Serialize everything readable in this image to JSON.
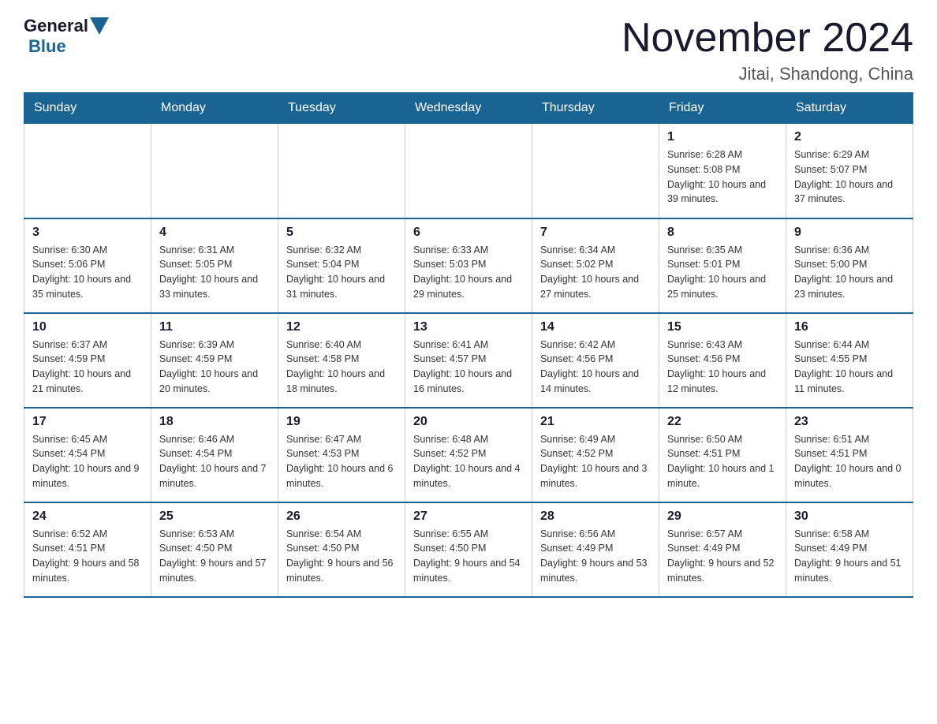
{
  "header": {
    "logo_general": "General",
    "logo_blue": "Blue",
    "month_title": "November 2024",
    "location": "Jitai, Shandong, China"
  },
  "weekdays": [
    "Sunday",
    "Monday",
    "Tuesday",
    "Wednesday",
    "Thursday",
    "Friday",
    "Saturday"
  ],
  "weeks": [
    [
      {
        "day": "",
        "info": ""
      },
      {
        "day": "",
        "info": ""
      },
      {
        "day": "",
        "info": ""
      },
      {
        "day": "",
        "info": ""
      },
      {
        "day": "",
        "info": ""
      },
      {
        "day": "1",
        "info": "Sunrise: 6:28 AM\nSunset: 5:08 PM\nDaylight: 10 hours and 39 minutes."
      },
      {
        "day": "2",
        "info": "Sunrise: 6:29 AM\nSunset: 5:07 PM\nDaylight: 10 hours and 37 minutes."
      }
    ],
    [
      {
        "day": "3",
        "info": "Sunrise: 6:30 AM\nSunset: 5:06 PM\nDaylight: 10 hours and 35 minutes."
      },
      {
        "day": "4",
        "info": "Sunrise: 6:31 AM\nSunset: 5:05 PM\nDaylight: 10 hours and 33 minutes."
      },
      {
        "day": "5",
        "info": "Sunrise: 6:32 AM\nSunset: 5:04 PM\nDaylight: 10 hours and 31 minutes."
      },
      {
        "day": "6",
        "info": "Sunrise: 6:33 AM\nSunset: 5:03 PM\nDaylight: 10 hours and 29 minutes."
      },
      {
        "day": "7",
        "info": "Sunrise: 6:34 AM\nSunset: 5:02 PM\nDaylight: 10 hours and 27 minutes."
      },
      {
        "day": "8",
        "info": "Sunrise: 6:35 AM\nSunset: 5:01 PM\nDaylight: 10 hours and 25 minutes."
      },
      {
        "day": "9",
        "info": "Sunrise: 6:36 AM\nSunset: 5:00 PM\nDaylight: 10 hours and 23 minutes."
      }
    ],
    [
      {
        "day": "10",
        "info": "Sunrise: 6:37 AM\nSunset: 4:59 PM\nDaylight: 10 hours and 21 minutes."
      },
      {
        "day": "11",
        "info": "Sunrise: 6:39 AM\nSunset: 4:59 PM\nDaylight: 10 hours and 20 minutes."
      },
      {
        "day": "12",
        "info": "Sunrise: 6:40 AM\nSunset: 4:58 PM\nDaylight: 10 hours and 18 minutes."
      },
      {
        "day": "13",
        "info": "Sunrise: 6:41 AM\nSunset: 4:57 PM\nDaylight: 10 hours and 16 minutes."
      },
      {
        "day": "14",
        "info": "Sunrise: 6:42 AM\nSunset: 4:56 PM\nDaylight: 10 hours and 14 minutes."
      },
      {
        "day": "15",
        "info": "Sunrise: 6:43 AM\nSunset: 4:56 PM\nDaylight: 10 hours and 12 minutes."
      },
      {
        "day": "16",
        "info": "Sunrise: 6:44 AM\nSunset: 4:55 PM\nDaylight: 10 hours and 11 minutes."
      }
    ],
    [
      {
        "day": "17",
        "info": "Sunrise: 6:45 AM\nSunset: 4:54 PM\nDaylight: 10 hours and 9 minutes."
      },
      {
        "day": "18",
        "info": "Sunrise: 6:46 AM\nSunset: 4:54 PM\nDaylight: 10 hours and 7 minutes."
      },
      {
        "day": "19",
        "info": "Sunrise: 6:47 AM\nSunset: 4:53 PM\nDaylight: 10 hours and 6 minutes."
      },
      {
        "day": "20",
        "info": "Sunrise: 6:48 AM\nSunset: 4:52 PM\nDaylight: 10 hours and 4 minutes."
      },
      {
        "day": "21",
        "info": "Sunrise: 6:49 AM\nSunset: 4:52 PM\nDaylight: 10 hours and 3 minutes."
      },
      {
        "day": "22",
        "info": "Sunrise: 6:50 AM\nSunset: 4:51 PM\nDaylight: 10 hours and 1 minute."
      },
      {
        "day": "23",
        "info": "Sunrise: 6:51 AM\nSunset: 4:51 PM\nDaylight: 10 hours and 0 minutes."
      }
    ],
    [
      {
        "day": "24",
        "info": "Sunrise: 6:52 AM\nSunset: 4:51 PM\nDaylight: 9 hours and 58 minutes."
      },
      {
        "day": "25",
        "info": "Sunrise: 6:53 AM\nSunset: 4:50 PM\nDaylight: 9 hours and 57 minutes."
      },
      {
        "day": "26",
        "info": "Sunrise: 6:54 AM\nSunset: 4:50 PM\nDaylight: 9 hours and 56 minutes."
      },
      {
        "day": "27",
        "info": "Sunrise: 6:55 AM\nSunset: 4:50 PM\nDaylight: 9 hours and 54 minutes."
      },
      {
        "day": "28",
        "info": "Sunrise: 6:56 AM\nSunset: 4:49 PM\nDaylight: 9 hours and 53 minutes."
      },
      {
        "day": "29",
        "info": "Sunrise: 6:57 AM\nSunset: 4:49 PM\nDaylight: 9 hours and 52 minutes."
      },
      {
        "day": "30",
        "info": "Sunrise: 6:58 AM\nSunset: 4:49 PM\nDaylight: 9 hours and 51 minutes."
      }
    ]
  ]
}
